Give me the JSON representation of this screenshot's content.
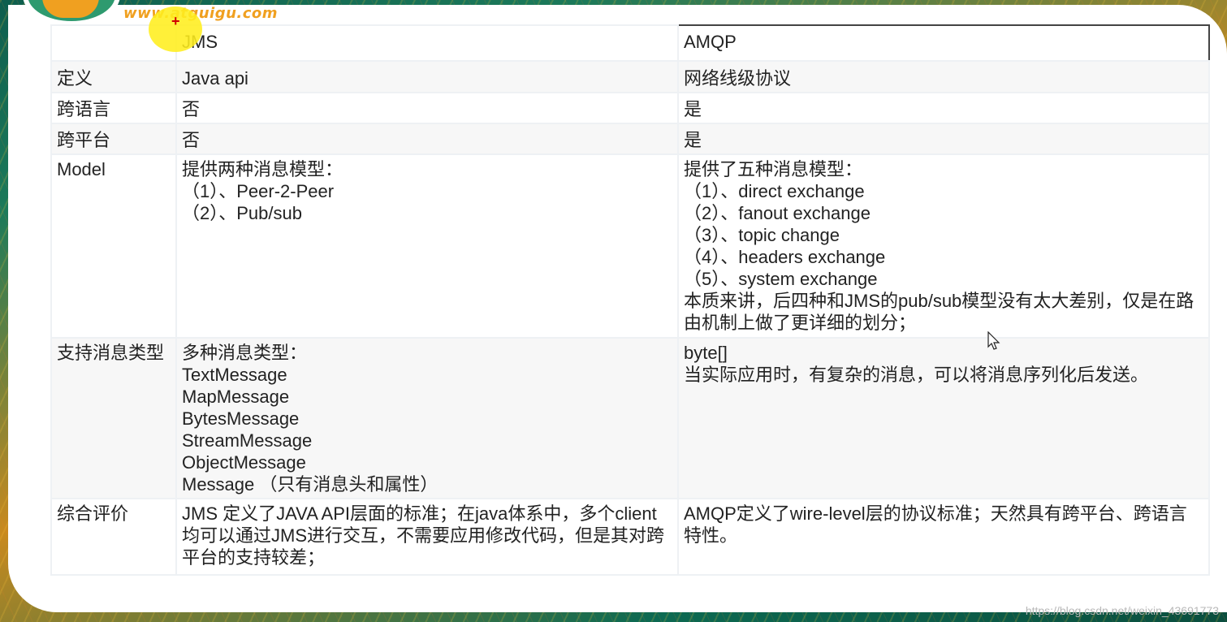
{
  "logo": {
    "url_text": "www.atguigu.com"
  },
  "table": {
    "header": {
      "col0": "",
      "jms": "JMS",
      "amqp": "AMQP"
    },
    "rows": [
      {
        "label": "定义",
        "jms": [
          "Java api"
        ],
        "amqp": [
          "网络线级协议"
        ]
      },
      {
        "label": "跨语言",
        "jms": [
          "否"
        ],
        "amqp": [
          "是"
        ]
      },
      {
        "label": "跨平台",
        "jms": [
          "否"
        ],
        "amqp": [
          "是"
        ]
      },
      {
        "label": "Model",
        "jms": [
          "提供两种消息模型：",
          "（1）、Peer-2-Peer",
          "（2）、Pub/sub"
        ],
        "amqp": [
          "提供了五种消息模型：",
          "（1）、direct exchange",
          "（2）、fanout exchange",
          "（3）、topic change",
          "（4）、headers exchange",
          "（5）、system exchange",
          "本质来讲，后四种和JMS的pub/sub模型没有太大差别，仅是在路由机制上做了更详细的划分；"
        ]
      },
      {
        "label": "支持消息类型",
        "jms": [
          "多种消息类型：",
          "TextMessage",
          "MapMessage",
          "BytesMessage",
          "StreamMessage",
          "ObjectMessage",
          "Message （只有消息头和属性）"
        ],
        "amqp": [
          "byte[]",
          "当实际应用时，有复杂的消息，可以将消息序列化后发送。"
        ]
      },
      {
        "label": "综合评价",
        "jms": [
          "JMS 定义了JAVA API层面的标准；在java体系中，多个client均可以通过JMS进行交互，不需要应用修改代码，但是其对跨平台的支持较差；"
        ],
        "amqp": [
          "AMQP定义了wire-level层的协议标准；天然具有跨平台、跨语言特性。"
        ]
      }
    ]
  },
  "watermark": "https://blog.csdn.net/weixin_43691773",
  "colors": {
    "header_border": "#444444",
    "highlight": "#ffee1e",
    "accent": "#f0a020"
  }
}
